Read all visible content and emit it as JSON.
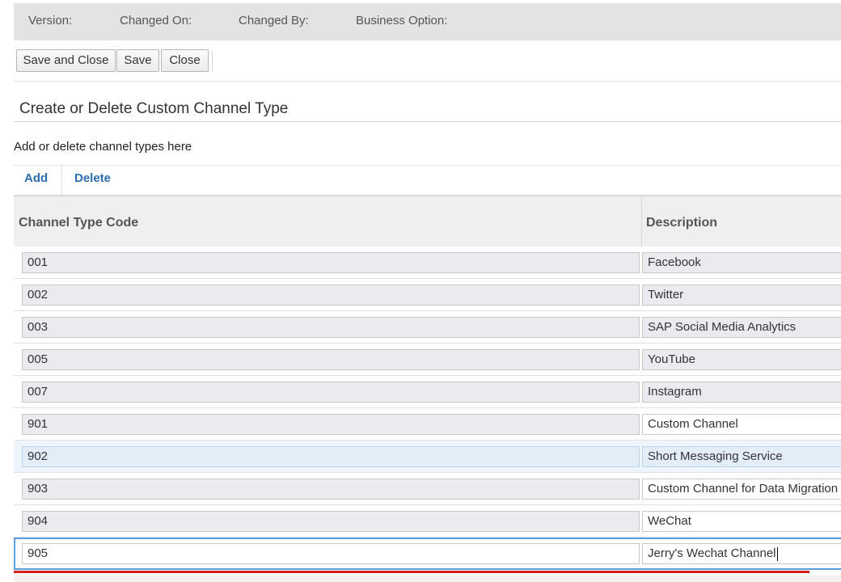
{
  "header": {
    "version_label": "Version:",
    "changed_on_label": "Changed On:",
    "changed_by_label": "Changed By:",
    "business_option_label": "Business Option:"
  },
  "toolbar": {
    "save_and_close": "Save and Close",
    "save": "Save",
    "close": "Close"
  },
  "section": {
    "title": "Create or Delete Custom Channel Type",
    "description": "Add or delete channel types here"
  },
  "actions": {
    "add": "Add",
    "delete": "Delete"
  },
  "table": {
    "columns": [
      "Channel Type Code",
      "Description"
    ],
    "rows": [
      {
        "code": "001",
        "description": "Facebook"
      },
      {
        "code": "002",
        "description": "Twitter"
      },
      {
        "code": "003",
        "description": "SAP Social Media Analytics"
      },
      {
        "code": "005",
        "description": "YouTube"
      },
      {
        "code": "007",
        "description": "Instagram"
      },
      {
        "code": "901",
        "description": "Custom Channel"
      },
      {
        "code": "902",
        "description": "Short Messaging Service"
      },
      {
        "code": "903",
        "description": "Custom Channel for Data Migration"
      },
      {
        "code": "904",
        "description": "WeChat"
      },
      {
        "code": "905",
        "description": "Jerry's Wechat Channel"
      }
    ]
  },
  "colors": {
    "accent": "#2b6cb0",
    "selection_border": "#5a9ee0",
    "highlight_row": "#eef4fc",
    "annotation": "#d32020"
  }
}
